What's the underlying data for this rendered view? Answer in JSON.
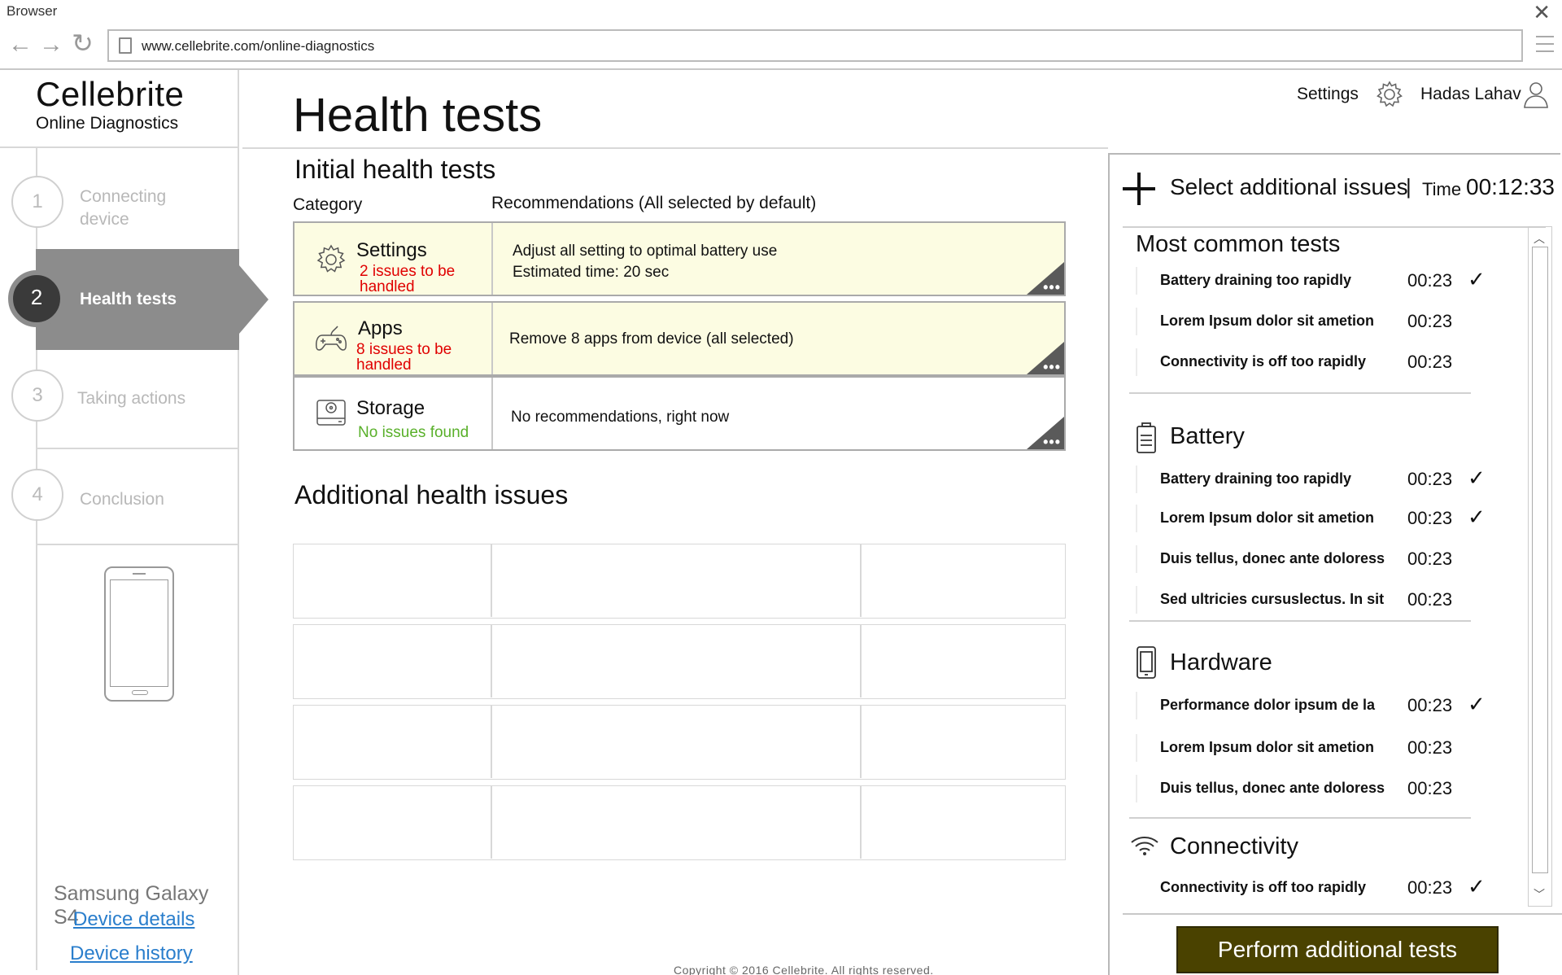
{
  "browser": {
    "title": "Browser",
    "url": "www.cellebrite.com/online-diagnostics"
  },
  "sidebar": {
    "brand": "Cellebrite",
    "brand_sub": "Online Diagnostics",
    "steps": [
      {
        "num": "1",
        "label_line1": "Connecting",
        "label_line2": "device"
      },
      {
        "num": "2",
        "label": "Health tests"
      },
      {
        "num": "3",
        "label": "Taking actions"
      },
      {
        "num": "4",
        "label": "Conclusion"
      }
    ],
    "device_name": "Samsung Galaxy S4",
    "device_details": "Device details",
    "device_history": "Device history"
  },
  "header": {
    "title": "Health tests",
    "settings": "Settings",
    "user": "Hadas Lahav"
  },
  "initial": {
    "title": "Initial health tests",
    "col_category": "Category",
    "col_recommendations": "Recommendations (All selected by default)",
    "rows": [
      {
        "name": "Settings",
        "issue_line1": "2 issues to be",
        "issue_line2": "handled",
        "rec_line1": "Adjust all setting to optimal battery use",
        "rec_line2": "Estimated time: 20 sec"
      },
      {
        "name": "Apps",
        "issue_line1": "8 issues to be",
        "issue_line2": "handled",
        "rec_line1": "Remove 8 apps from device (all selected)"
      },
      {
        "name": "Storage",
        "issue_line1": "No issues found",
        "rec_line1": "No recommendations, right now"
      }
    ],
    "more_glyph": "•••"
  },
  "additional": {
    "title": "Additional health issues"
  },
  "footer": {
    "copyright": "Copyright © 2016 Cellebrite. All rights reserved."
  },
  "panel": {
    "heading": "Select additional issues",
    "separator": "|",
    "time_label": "Time",
    "time_value": "00:12:33",
    "groups": [
      {
        "title": "Most common tests",
        "icon": "none",
        "tests": [
          {
            "name": "Battery draining too rapidly",
            "time": "00:23",
            "check": "✓"
          },
          {
            "name": "Lorem Ipsum dolor sit ametion",
            "time": "00:23",
            "check": ""
          },
          {
            "name": "Connectivity is off too rapidly",
            "time": "00:23",
            "check": ""
          }
        ]
      },
      {
        "title": "Battery",
        "icon": "battery-icon",
        "tests": [
          {
            "name": "Battery draining too rapidly",
            "time": "00:23",
            "check": "✓"
          },
          {
            "name": "Lorem Ipsum dolor sit ametion",
            "time": "00:23",
            "check": "✓"
          },
          {
            "name": "Duis tellus, donec ante doloress",
            "time": "00:23",
            "check": ""
          },
          {
            "name": "Sed ultricies cursuslectus. In sit",
            "time": "00:23",
            "check": ""
          }
        ]
      },
      {
        "title": "Hardware",
        "icon": "phone-icon",
        "tests": [
          {
            "name": "Performance dolor ipsum de la",
            "time": "00:23",
            "check": "✓"
          },
          {
            "name": "Lorem Ipsum dolor sit ametion",
            "time": "00:23",
            "check": ""
          },
          {
            "name": "Duis tellus, donec ante doloress",
            "time": "00:23",
            "check": ""
          }
        ]
      },
      {
        "title": "Connectivity",
        "icon": "wifi-icon",
        "tests": [
          {
            "name": "Connectivity is off too rapidly",
            "time": "00:23",
            "check": "✓"
          }
        ]
      }
    ],
    "perform_button": "Perform additional tests"
  }
}
